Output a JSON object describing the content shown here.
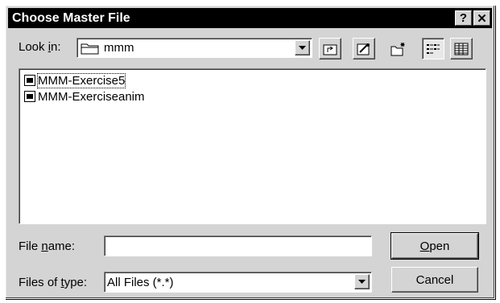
{
  "window": {
    "title": "Choose Master File",
    "help_glyph": "?",
    "close_glyph": "✕"
  },
  "lookin": {
    "label_pre": "Look ",
    "label_key": "i",
    "label_post": "n:",
    "value": "mmm",
    "folder_icon": "folder-icon"
  },
  "toolbar": {
    "up_one_level": "up-folder-icon",
    "desktop": "desktop-icon",
    "new_folder": "new-folder-icon",
    "list_view": "list-view-icon",
    "details_view": "details-view-icon"
  },
  "files": [
    {
      "name": "MMM-Exercise5"
    },
    {
      "name": "MMM-Exerciseanim"
    }
  ],
  "filename": {
    "label_pre": "File ",
    "label_key": "n",
    "label_post": "ame:",
    "value": ""
  },
  "filetype": {
    "label_pre": "Files of ",
    "label_key": "t",
    "label_post": "ype:",
    "value": "All Files (*.*)"
  },
  "buttons": {
    "open_key": "O",
    "open_rest": "pen",
    "cancel": "Cancel"
  }
}
